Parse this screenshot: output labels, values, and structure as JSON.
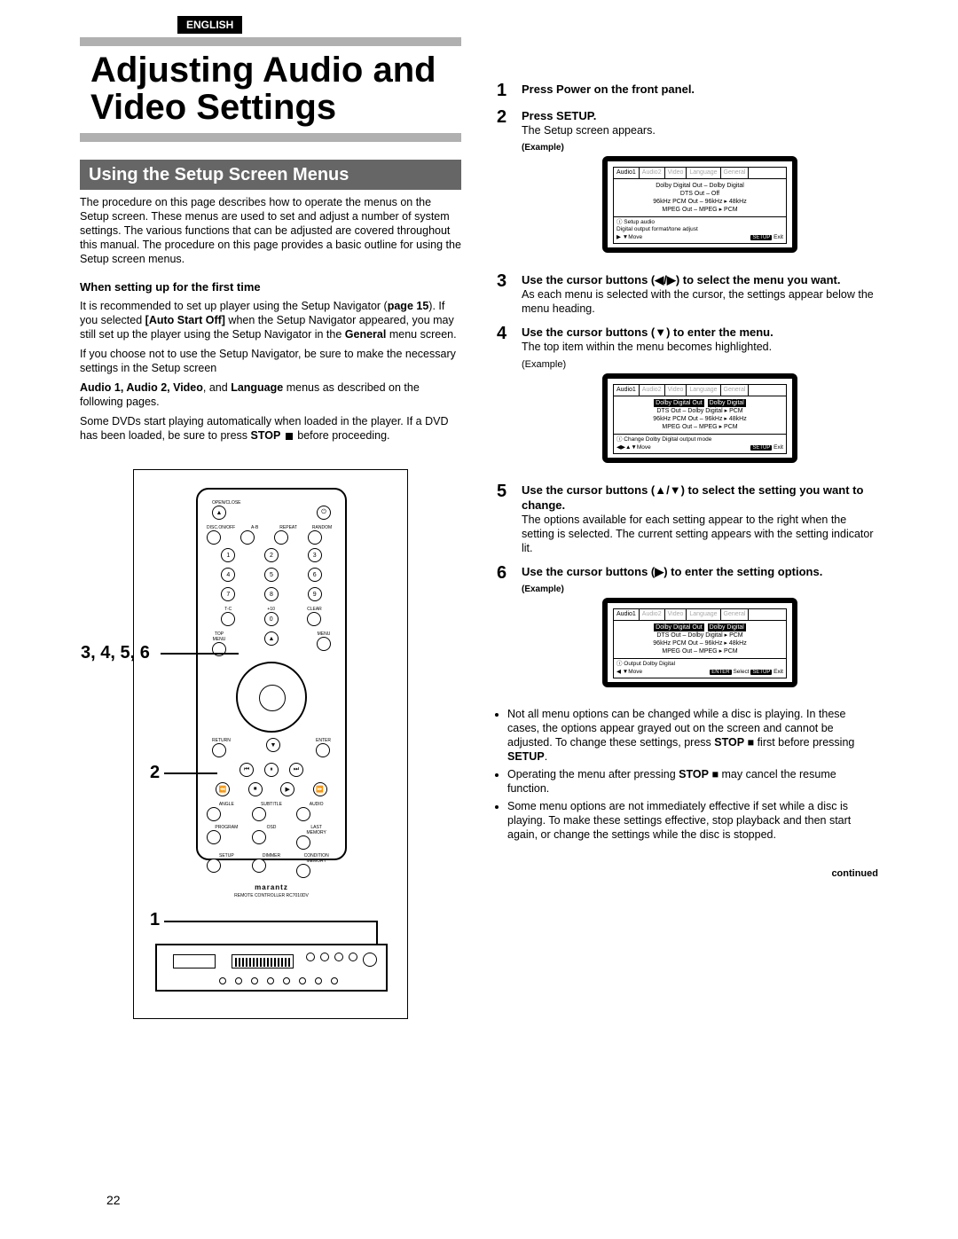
{
  "lang_badge": "ENGLISH",
  "title": "Adjusting Audio and Video Settings",
  "section_header": "Using the Setup Screen Menus",
  "intro": "The procedure on this page describes how to operate the menus on the Setup screen. These menus are used to set and adjust a number of system settings. The various functions that can be adjusted are covered throughout this manual. The procedure on this page provides a basic outline for using the Setup screen menus.",
  "first_time_hdr": "When setting up for the first time",
  "first_time_body_a": "It is recommended to set up player using the Setup Navigator (",
  "first_time_page_ref": "page 15",
  "first_time_body_b": "). If you selected ",
  "first_time_auto": "[Auto Start Off]",
  "first_time_body_c": " when the Setup Navigator appeared, you may still set up the player using the Setup Navigator in the ",
  "first_time_general": "General",
  "first_time_body_d": " menu screen.",
  "first_time_line2": "If you choose not to use the Setup Navigator, be sure to make the necessary settings in the Setup screen",
  "first_time_menus_bold": "Audio 1, Audio 2, Video",
  "first_time_menus_mid": ", and ",
  "first_time_menus_lang": "Language",
  "first_time_menus_end": " menus as described on the following pages.",
  "first_time_line3a": "Some DVDs start playing automatically when loaded in the player. If a DVD has been loaded, be sure to press ",
  "first_time_stop": "STOP",
  "first_time_line3b": " before proceeding.",
  "callout_3456": "3, 4, 5, 6",
  "callout_2": "2",
  "callout_1": "1",
  "remote_brand": "marantz",
  "remote_sub": "REMOTE CONTROLLER\nRC7010DV",
  "steps": [
    {
      "num": "1",
      "bold": "Press Power on the front panel."
    },
    {
      "num": "2",
      "bold": "Press SETUP.",
      "body": "The Setup screen appears.",
      "example_label": "(Example)",
      "osd": {
        "tabs": [
          "Audio1",
          "Audio2",
          "Video",
          "Language",
          "General"
        ],
        "lines": [
          "Dolby Digital Out – Dolby Digital",
          "DTS Out – Off",
          "96kHz PCM Out – 96kHz ▸ 48kHz",
          "MPEG Out – MPEG ▸ PCM"
        ],
        "help1": "ⓘ Setup audio",
        "help2": "Digital output format/tone adjust",
        "foot_left": "▶  ▼Move",
        "foot_right_btn": "SETUP",
        "foot_right": "Exit"
      }
    },
    {
      "num": "3",
      "bold": "Use the cursor buttons (◀/▶) to select the menu you want.",
      "body": "As each menu is selected with the cursor, the settings appear below the menu heading."
    },
    {
      "num": "4",
      "bold": "Use the cursor buttons (▼) to enter the menu.",
      "body": "The top item within the menu becomes highlighted.",
      "example_label_plain": "(Example)",
      "osd": {
        "tabs": [
          "Audio1",
          "Audio2",
          "Video",
          "Language",
          "General"
        ],
        "hl_left": "Dolby Digital Out",
        "hl_right": "Dolby Digital",
        "lines": [
          "DTS Out – Dolby Digital ▸ PCM",
          "96kHz PCM Out – 96kHz ▸ 48kHz",
          "MPEG Out – MPEG ▸ PCM"
        ],
        "help1": "ⓘ Change Dolby Digital output mode",
        "foot_left": "◀▶▲▼Move",
        "foot_right_btn": "SETUP",
        "foot_right": "Exit"
      }
    },
    {
      "num": "5",
      "bold": "Use the cursor buttons (▲/▼) to select the setting you want to change.",
      "body": "The options available for each setting appear to the right when the setting is selected. The current setting appears with the setting indicator lit."
    },
    {
      "num": "6",
      "bold": "Use the cursor buttons (▶)  to enter the setting options.",
      "example_label": "(Example)",
      "osd": {
        "tabs": [
          "Audio1",
          "Audio2",
          "Video",
          "Language",
          "General"
        ],
        "hl_left": "Dolby Digital Out",
        "hl_right": "Dolby Digital",
        "lines": [
          "DTS Out – Dolby Digital ▸ PCM",
          "96kHz PCM Out – 96kHz ▸ 48kHz",
          "MPEG Out – MPEG ▸ PCM"
        ],
        "help1": "ⓘ Output Dolby Digital",
        "foot_left": "◀   ▼Move",
        "foot_mid_btn": "ENTER",
        "foot_mid": "Select",
        "foot_right_btn": "SETUP",
        "foot_right": "Exit"
      }
    }
  ],
  "bullets": [
    {
      "pre": "Not all menu options can be changed while a disc is playing. In these cases, the options appear grayed out on the screen and cannot be adjusted. To change these settings, press ",
      "b1": "STOP",
      "mid": " ■ first before pressing ",
      "b2": "SETUP",
      "post": "."
    },
    {
      "pre": "Operating the menu after pressing ",
      "b1": "STOP",
      "mid": " ■ may cancel the resume function.",
      "b2": "",
      "post": ""
    },
    {
      "pre": "Some menu options are not immediately effective if set while a disc is playing. To make these settings effective, stop playback and then start again, or change the settings while the disc is stopped.",
      "b1": "",
      "mid": "",
      "b2": "",
      "post": ""
    }
  ],
  "continued": "continued",
  "page_number": "22"
}
